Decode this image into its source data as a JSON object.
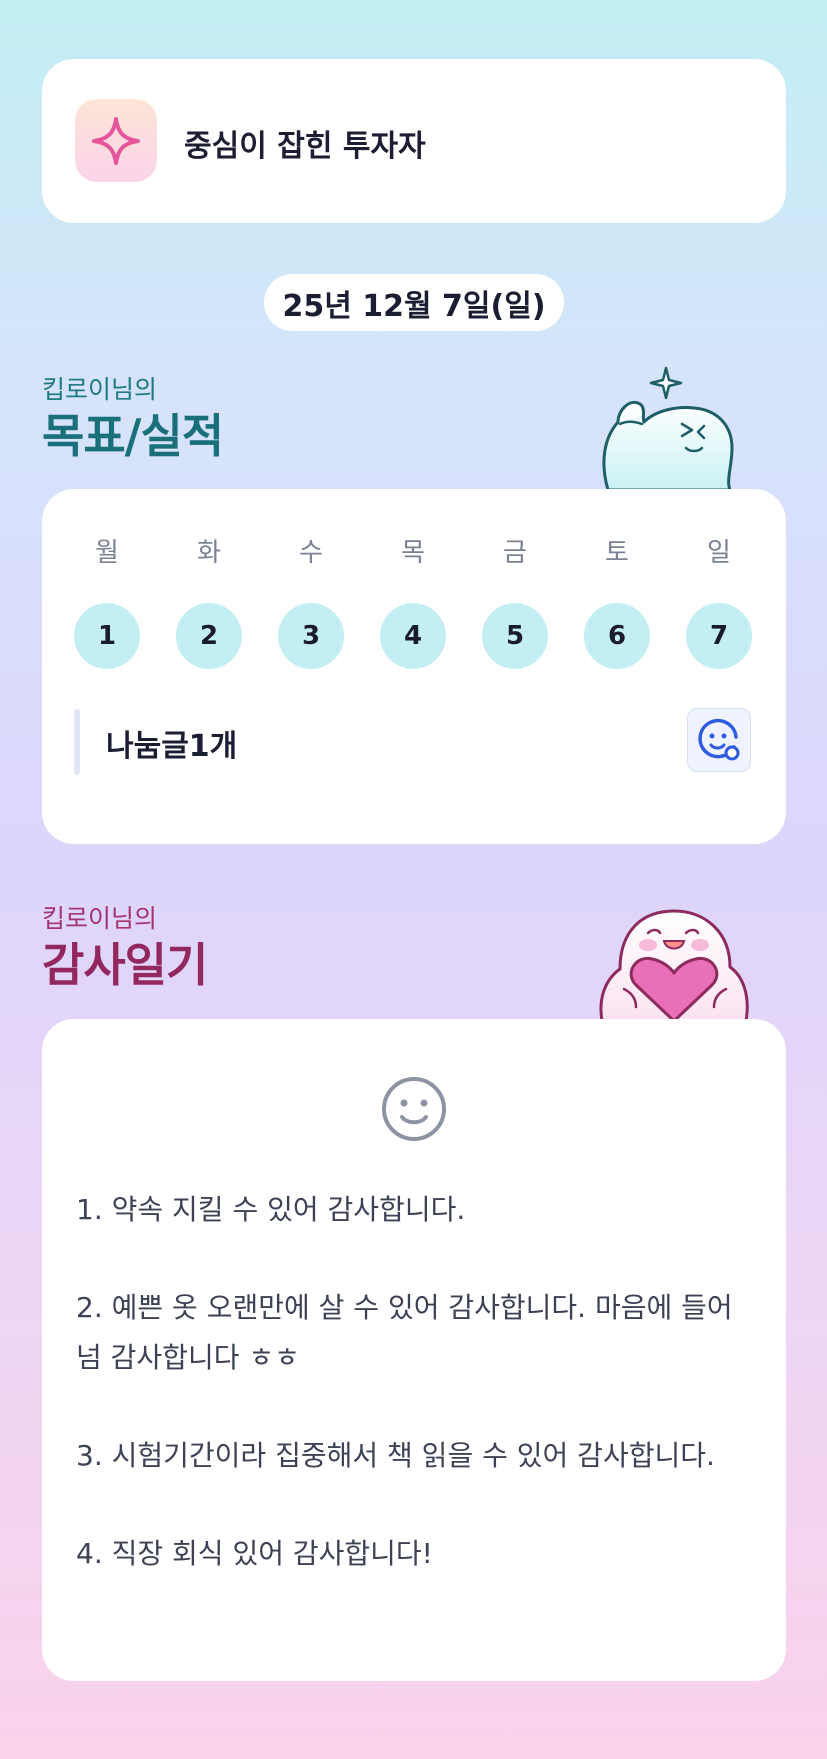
{
  "badge": {
    "icon": "sparkle-icon",
    "title": "중심이 잡힌 투자자"
  },
  "date": "25년 12월 7일(일)",
  "goal_section": {
    "subtitle": "킵로이님의",
    "title": "목표/실적",
    "mascot": "thumbs-up-mascot"
  },
  "week": {
    "days": [
      {
        "label": "월",
        "number": "1"
      },
      {
        "label": "화",
        "number": "2"
      },
      {
        "label": "수",
        "number": "3"
      },
      {
        "label": "목",
        "number": "4"
      },
      {
        "label": "금",
        "number": "5"
      },
      {
        "label": "토",
        "number": "6"
      },
      {
        "label": "일",
        "number": "7"
      }
    ],
    "share_label": "나눔글1개",
    "share_icon": "smile-plus-icon"
  },
  "gratitude_section": {
    "subtitle": "킵로이님의",
    "title": "감사일기",
    "mascot": "heart-hug-mascot",
    "icon": "smile-icon",
    "entries": [
      "1. 약속 지킬 수 있어 감사합니다.",
      "2. 예쁜 옷 오랜만에 살 수 있어 감사합니다. 마음에 들어 넘 감사합니다 ㅎㅎ",
      "3. 시험기간이라 집중해서 책 읽을 수 있어 감사합니다.",
      "4. 직장 회식 있어 감사합니다!"
    ]
  },
  "colors": {
    "accent_teal": "#19707a",
    "accent_plum": "#93275f",
    "day_circle": "#c3eff4",
    "icon_blue": "#2e5be0"
  }
}
